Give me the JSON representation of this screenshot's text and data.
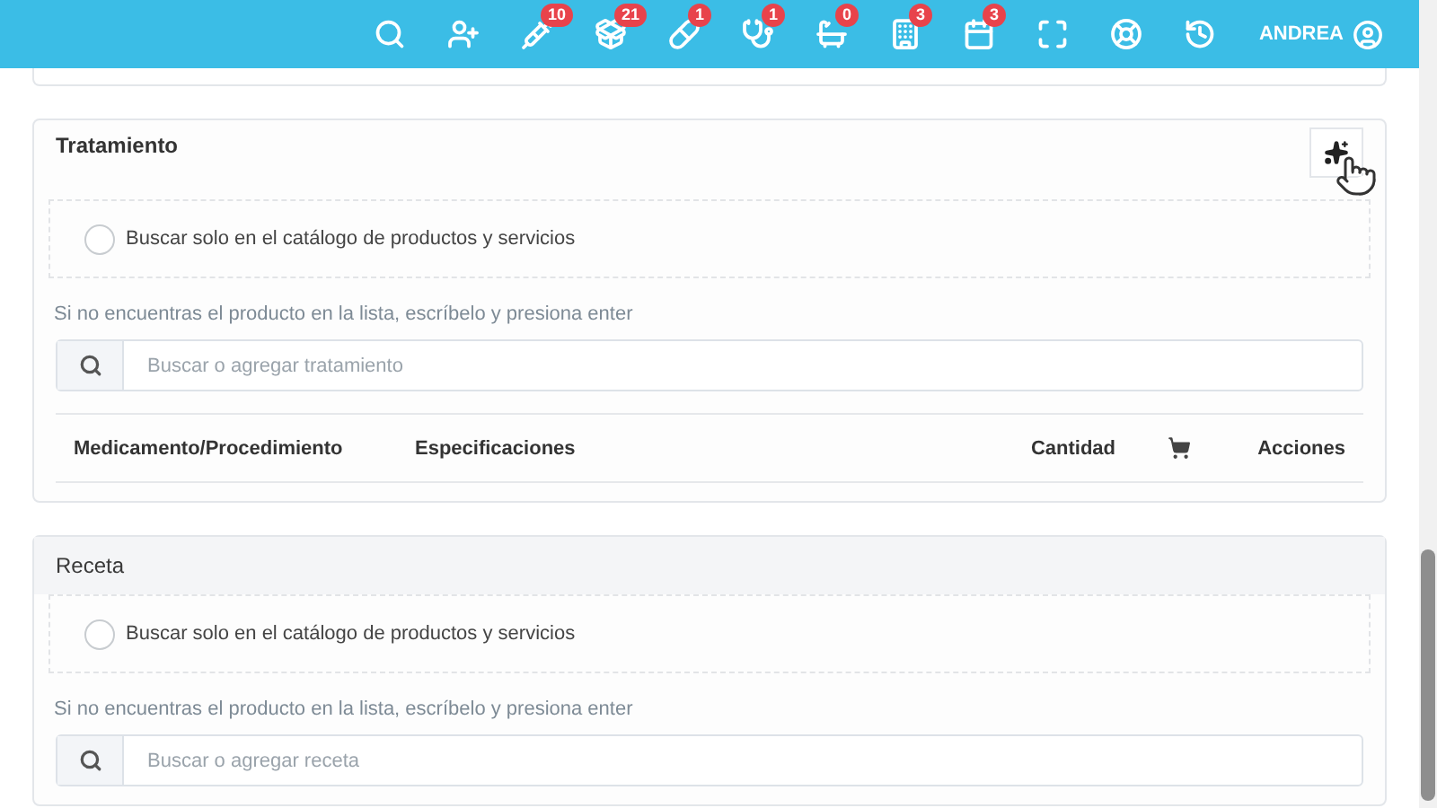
{
  "topbar": {
    "items": [
      {
        "kind": "search"
      },
      {
        "kind": "add-user"
      },
      {
        "kind": "syringe",
        "badge": "10"
      },
      {
        "kind": "box",
        "badge": "21"
      },
      {
        "kind": "pills",
        "badge": "1"
      },
      {
        "kind": "stethoscope",
        "badge": "1"
      },
      {
        "kind": "bath",
        "badge": "0"
      },
      {
        "kind": "building",
        "badge": "3"
      },
      {
        "kind": "calendar",
        "badge": "3"
      },
      {
        "kind": "expand"
      },
      {
        "kind": "lifebuoy"
      },
      {
        "kind": "history"
      }
    ],
    "user": "ANDREA"
  },
  "sections": [
    {
      "title": "Tratamiento",
      "header_shaded": false,
      "ai_button": true,
      "catalog_only": {
        "label": "Buscar solo en el catálogo de productos y servicios",
        "checked": false
      },
      "hint": "Si no encuentras el producto en la lista, escríbelo y presiona enter",
      "search": {
        "placeholder": "Buscar o agregar tratamiento"
      },
      "columns": [
        {
          "kind": "text",
          "label": "Medicamento/Procedimiento"
        },
        {
          "kind": "text",
          "label": "Especificaciones"
        },
        {
          "kind": "text",
          "label": "Cantidad"
        },
        {
          "kind": "cart"
        },
        {
          "kind": "text",
          "label": "Acciones"
        }
      ]
    },
    {
      "title": "Receta",
      "header_shaded": true,
      "ai_button": false,
      "catalog_only": {
        "label": "Buscar solo en el catálogo de productos y servicios",
        "checked": false
      },
      "hint": "Si no encuentras el producto en la lista, escríbelo y presiona enter",
      "search": {
        "placeholder": "Buscar o agregar receta"
      }
    }
  ]
}
